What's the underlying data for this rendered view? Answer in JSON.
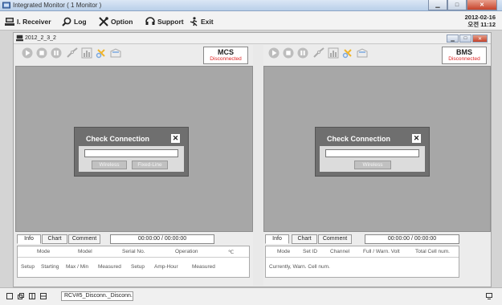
{
  "window": {
    "title": "Integrated Monitor ( 1 Monitor )"
  },
  "menu": {
    "items": [
      {
        "label": "I. Receiver",
        "icon": "receiver-icon"
      },
      {
        "label": "Log",
        "icon": "search-icon"
      },
      {
        "label": "Option",
        "icon": "tools-icon"
      },
      {
        "label": "Support",
        "icon": "support-icon"
      },
      {
        "label": "Exit",
        "icon": "exit-icon"
      }
    ],
    "date": "2012-02-16",
    "time": "오전 11:12"
  },
  "child": {
    "title": "2012_2_3_2"
  },
  "panels": {
    "left": {
      "status": {
        "name": "MCS",
        "state": "Disconnected"
      },
      "dialog": {
        "title": "Check Connection",
        "close": "✕",
        "buttons": [
          "Wireless",
          "Fixed-Line"
        ]
      },
      "tabs": [
        "Info",
        "Chart",
        "Comment"
      ],
      "time": "00:00:00 / 00:00:00",
      "info_row1": [
        "Mode",
        "Model",
        "Serial No.",
        "Operation",
        "℃"
      ],
      "info_row2": [
        "Setup",
        "Starting",
        "Max / Min",
        "Measured",
        "Setup",
        "Amp-Hour",
        "Measured"
      ]
    },
    "right": {
      "status": {
        "name": "BMS",
        "state": "Disconnected"
      },
      "dialog": {
        "title": "Check Connection",
        "close": "✕",
        "buttons": [
          "Wireless"
        ]
      },
      "tabs": [
        "Info",
        "Chart",
        "Comment"
      ],
      "time": "00:00:00 / 00:00:00",
      "info_row1": [
        "Mode",
        "Set ID",
        "Channel",
        "Full / Warn. Volt",
        "Total Cell num."
      ],
      "info_row2": [
        "Currently, Warn. Cell num."
      ]
    }
  },
  "statusbar": {
    "field": "RCV#5_Disconn._Disconn."
  }
}
